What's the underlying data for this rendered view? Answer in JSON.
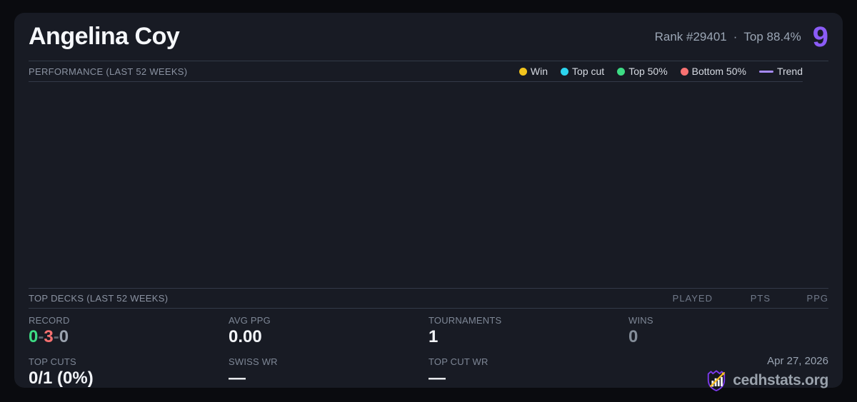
{
  "header": {
    "title": "Angelina Coy",
    "rank": "Rank #29401",
    "separator": "·",
    "top_percent": "Top 88.4%",
    "score": "9",
    "score_color": "#8b5cf6"
  },
  "performance": {
    "heading": "PERFORMANCE (LAST 52 WEEKS)",
    "legend": {
      "win": {
        "label": "Win",
        "color": "#f2c41d"
      },
      "top_cut": {
        "label": "Top cut",
        "color": "#2cd4ee"
      },
      "top_50": {
        "label": "Top 50%",
        "color": "#3ddc84"
      },
      "bottom_50": {
        "label": "Bottom 50%",
        "color": "#f87171"
      },
      "trend": {
        "label": "Trend",
        "color": "#a78bfa"
      }
    },
    "plot_points": []
  },
  "top_decks": {
    "heading": "TOP DECKS (LAST 52 WEEKS)",
    "columns": {
      "played": "PLAYED",
      "pts": "PTS",
      "ppg": "PPG"
    },
    "rows": []
  },
  "stats": {
    "record": {
      "label": "RECORD",
      "wins": "0",
      "losses": "3",
      "draws": "0",
      "separator": "-",
      "wins_color": "#3ddc84",
      "losses_color": "#f87171",
      "draws_color": "#9aa2ae",
      "separator_color": "#5d6470"
    },
    "avg_ppg": {
      "label": "AVG PPG",
      "value": "0.00"
    },
    "tournaments": {
      "label": "TOURNAMENTS",
      "value": "1"
    },
    "wins": {
      "label": "WINS",
      "value": "0",
      "value_color": "#848d99"
    },
    "top_cuts": {
      "label": "TOP CUTS",
      "value": "0/1 (0%)"
    },
    "swiss_wr": {
      "label": "SWISS WR",
      "value": "—"
    },
    "top_cut_wr": {
      "label": "TOP CUT WR",
      "value": "—"
    }
  },
  "footer": {
    "date": "Apr 27, 2026",
    "brand": "cedhstats.org",
    "logo_shield_color": "#7c3aed",
    "logo_arrow_color": "#fbbf24"
  }
}
